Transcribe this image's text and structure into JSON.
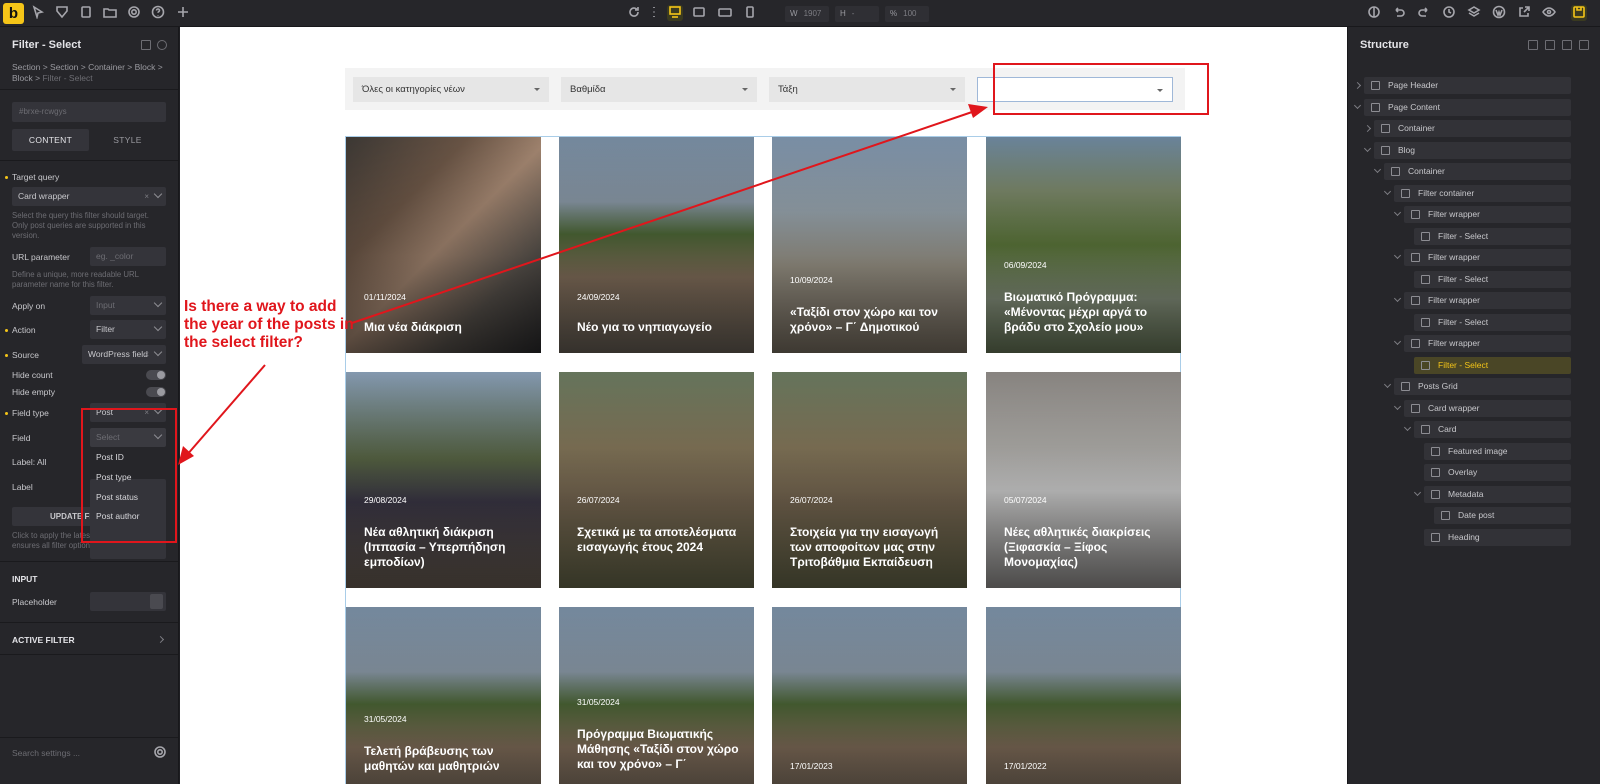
{
  "toolbar": {
    "logo": "b",
    "width_label": "W",
    "width_value": "1907",
    "height_label": "H",
    "height_value": "-",
    "zoom_label": "%",
    "zoom_value": "100"
  },
  "left_panel": {
    "title": "Filter - Select",
    "breadcrumb": "Section > Section > Container > Block > Block > ",
    "breadcrumb_current": "Filter - Select",
    "element_id": "#brxe-rcwgys",
    "tabs": [
      "CONTENT",
      "STYLE"
    ],
    "target_query_label": "Target query",
    "target_query_value": "Card wrapper",
    "target_query_help": "Select the query this filter should target. Only post queries are supported in this version.",
    "url_param_label": "URL parameter",
    "url_param_placeholder": "eg. _color",
    "url_param_help": "Define a unique, more readable URL parameter name for this filter.",
    "apply_on_label": "Apply on",
    "apply_on_value": "Input",
    "action_label": "Action",
    "action_value": "Filter",
    "source_label": "Source",
    "source_value": "WordPress field",
    "hide_count_label": "Hide count",
    "hide_empty_label": "Hide empty",
    "field_type_label": "Field type",
    "field_type_value": "Post",
    "field_label": "Field",
    "field_placeholder": "Select",
    "label_all_label": "Label: All",
    "label_label": "Label",
    "field_options": [
      "Post ID",
      "Post type",
      "Post status",
      "Post author"
    ],
    "update_button": "UPDATE FI",
    "update_help": "Click to apply the latest filter settings. This ensures all filter options are up-to-date.",
    "input_section": "INPUT",
    "placeholder_label": "Placeholder",
    "active_filter_section": "ACTIVE FILTER",
    "search_placeholder": "Search settings ..."
  },
  "canvas": {
    "filters": [
      "Όλες οι κατηγορίες νέων",
      "Βαθμίδα",
      "Τάξη",
      ""
    ],
    "cards": [
      {
        "date": "01/11/2024",
        "title": "Μια νέα διάκριση"
      },
      {
        "date": "24/09/2024",
        "title": "Νέο για το νηπιαγωγείο"
      },
      {
        "date": "10/09/2024",
        "title": "«Ταξίδι στον χώρο και τον χρόνο» – Γ΄ Δημοτικού"
      },
      {
        "date": "06/09/2024",
        "title": "Βιωματικό Πρόγραμμα: «Μένοντας μέχρι αργά το βράδυ στο Σχολείο μου»"
      },
      {
        "date": "29/08/2024",
        "title": "Νέα αθλητική διάκριση (Ιππασία – Υπερπήδηση εμποδίων)"
      },
      {
        "date": "26/07/2024",
        "title": "Σχετικά με τα αποτελέσματα εισαγωγής έτους 2024"
      },
      {
        "date": "26/07/2024",
        "title": "Στοιχεία για την εισαγωγή των αποφοίτων μας στην Τριτοβάθμια Εκπαίδευση"
      },
      {
        "date": "05/07/2024",
        "title": "Νέες αθλητικές διακρίσεις (Ξιφασκία – Ξίφος Μονομαχίας)"
      },
      {
        "date": "31/05/2024",
        "title": "Τελετή βράβευσης των μαθητών και μαθητριών"
      },
      {
        "date": "31/05/2024",
        "title": "Πρόγραμμα Βιωματικής Μάθησης «Ταξίδι στον χώρο και τον χρόνο» – Γ΄"
      },
      {
        "date": "17/01/2023",
        "title": ""
      },
      {
        "date": "17/01/2022",
        "title": ""
      }
    ]
  },
  "annotation": {
    "text": "Is there a way to add the year of the posts in the select filter?",
    "color": "#e0161c"
  },
  "structure": {
    "title": "Structure",
    "nodes": [
      {
        "label": "Page Header",
        "depth": 0,
        "caret": "right"
      },
      {
        "label": "Page Content",
        "depth": 0,
        "caret": "down"
      },
      {
        "label": "Container",
        "depth": 1,
        "caret": "right"
      },
      {
        "label": "Blog",
        "depth": 1,
        "caret": "down"
      },
      {
        "label": "Container",
        "depth": 2,
        "caret": "down"
      },
      {
        "label": "Filter container",
        "depth": 3,
        "caret": "down"
      },
      {
        "label": "Filter wrapper",
        "depth": 4,
        "caret": "down"
      },
      {
        "label": "Filter - Select",
        "depth": 5,
        "caret": ""
      },
      {
        "label": "Filter wrapper",
        "depth": 4,
        "caret": "down"
      },
      {
        "label": "Filter - Select",
        "depth": 5,
        "caret": ""
      },
      {
        "label": "Filter wrapper",
        "depth": 4,
        "caret": "down"
      },
      {
        "label": "Filter - Select",
        "depth": 5,
        "caret": ""
      },
      {
        "label": "Filter wrapper",
        "depth": 4,
        "caret": "down"
      },
      {
        "label": "Filter - Select",
        "depth": 5,
        "caret": "",
        "active": true
      },
      {
        "label": "Posts Grid",
        "depth": 3,
        "caret": "down"
      },
      {
        "label": "Card wrapper",
        "depth": 4,
        "caret": "down"
      },
      {
        "label": "Card",
        "depth": 5,
        "caret": "down"
      },
      {
        "label": "Featured image",
        "depth": 6,
        "caret": ""
      },
      {
        "label": "Overlay",
        "depth": 6,
        "caret": ""
      },
      {
        "label": "Metadata",
        "depth": 6,
        "caret": "down"
      },
      {
        "label": "Date post",
        "depth": 7,
        "caret": ""
      },
      {
        "label": "Heading",
        "depth": 6,
        "caret": ""
      }
    ]
  },
  "colors": {
    "accent": "#f5c518",
    "panel": "#26262a",
    "annotation": "#e0161c"
  }
}
